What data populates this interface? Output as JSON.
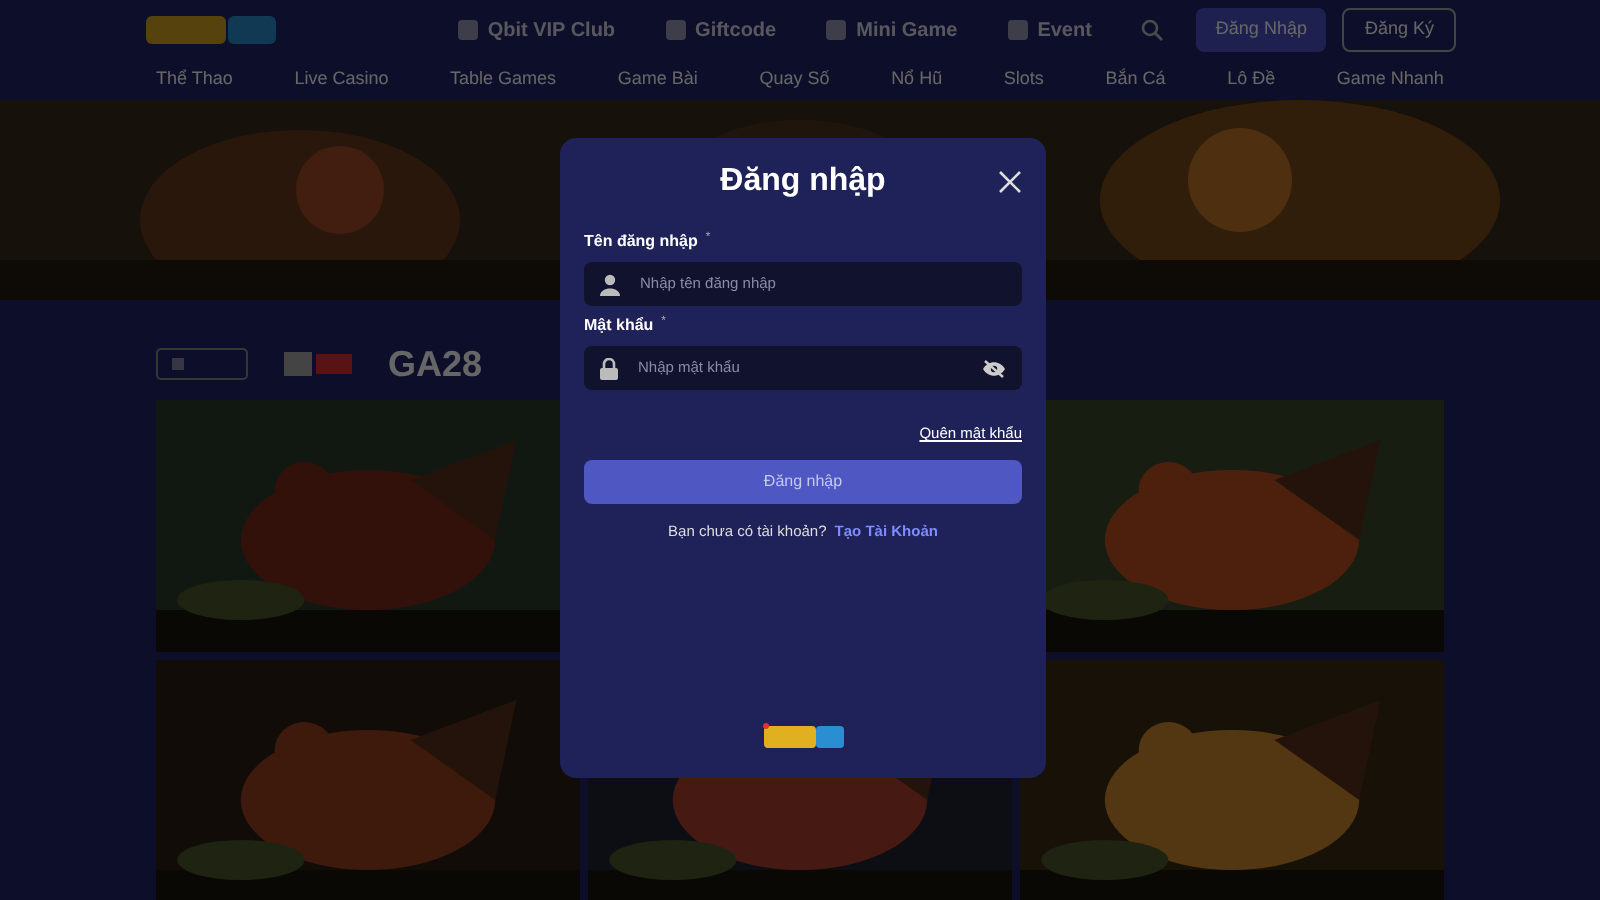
{
  "header": {
    "nav_links": [
      {
        "label": "Qbit VIP Club"
      },
      {
        "label": "Giftcode"
      },
      {
        "label": "Mini Game"
      },
      {
        "label": "Event"
      }
    ],
    "login_button": "Đăng Nhập",
    "register_button": "Đăng Ký",
    "categories": [
      {
        "label": "Thể Thao"
      },
      {
        "label": "Live Casino"
      },
      {
        "label": "Table Games"
      },
      {
        "label": "Game Bài"
      },
      {
        "label": "Quay Số"
      },
      {
        "label": "Nổ Hũ"
      },
      {
        "label": "Slots"
      },
      {
        "label": "Bắn Cá"
      },
      {
        "label": "Lô Đề"
      },
      {
        "label": "Game Nhanh"
      }
    ]
  },
  "providers": [
    {
      "label": "GA28"
    }
  ],
  "modal": {
    "title": "Đăng nhập",
    "fields": [
      {
        "kind": "text",
        "label": "Tên đăng nhập",
        "required_mark": "*",
        "placeholder": "Nhập tên đăng nhập"
      },
      {
        "kind": "password",
        "label": "Mật khẩu",
        "required_mark": "*",
        "placeholder": "Nhập mật khẩu"
      }
    ],
    "forgot_link": "Quên mật khẩu",
    "submit_button": "Đăng nhập",
    "signup_prompt": "Bạn chưa có tài khoản?",
    "signup_link": "Tạo Tài Khoản"
  }
}
